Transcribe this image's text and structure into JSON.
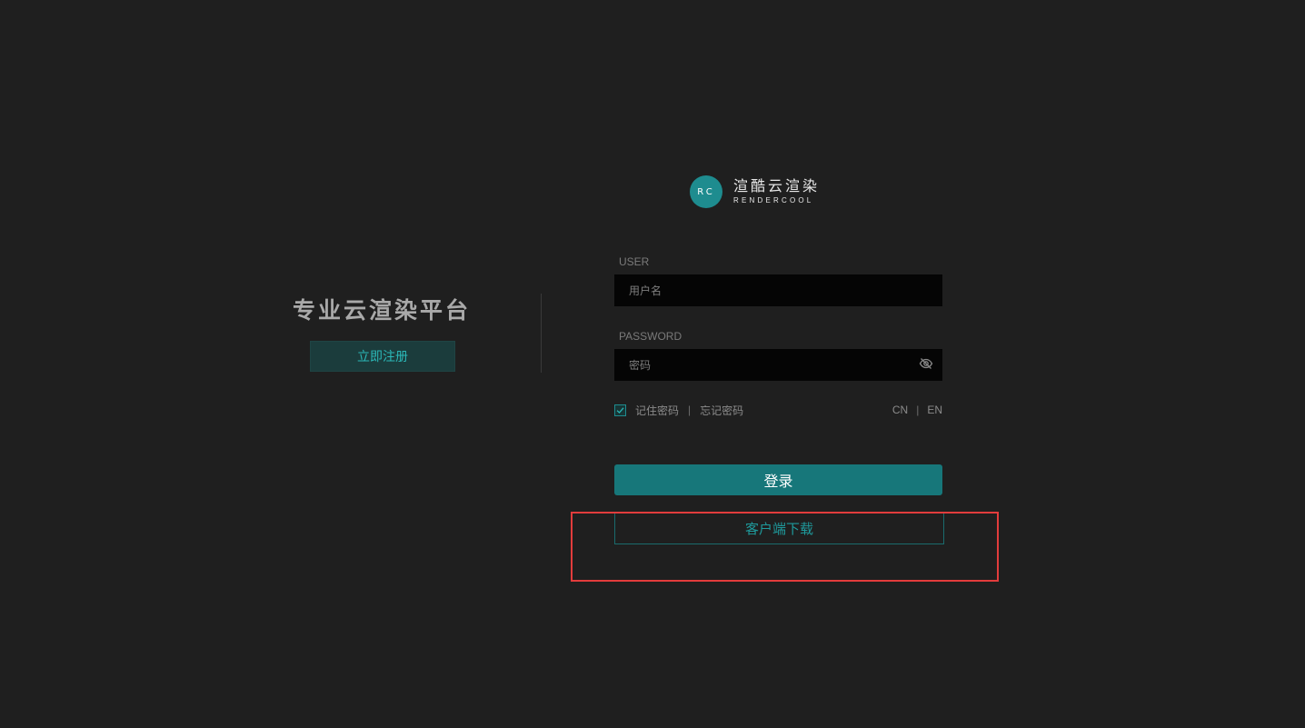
{
  "promo": {
    "title": "专业云渲染平台",
    "register_label": "立即注册"
  },
  "logo": {
    "mark": "RC",
    "name_cn": "渲酷云渲染",
    "name_en": "RENDERCOOL"
  },
  "form": {
    "user_label": "USER",
    "user_placeholder": "用户名",
    "password_label": "PASSWORD",
    "password_placeholder": "密码",
    "remember_label": "记住密码",
    "remember_checked": true,
    "separator": "|",
    "forgot_label": "忘记密码",
    "lang_cn": "CN",
    "lang_en": "EN",
    "login_label": "登录",
    "download_label": "客户端下载"
  },
  "colors": {
    "background": "#1f1f1f",
    "accent": "#17777a",
    "highlight": "#e23c3c"
  },
  "icons": {
    "password_toggle": "eye-slash-icon",
    "checkbox": "check-icon"
  }
}
